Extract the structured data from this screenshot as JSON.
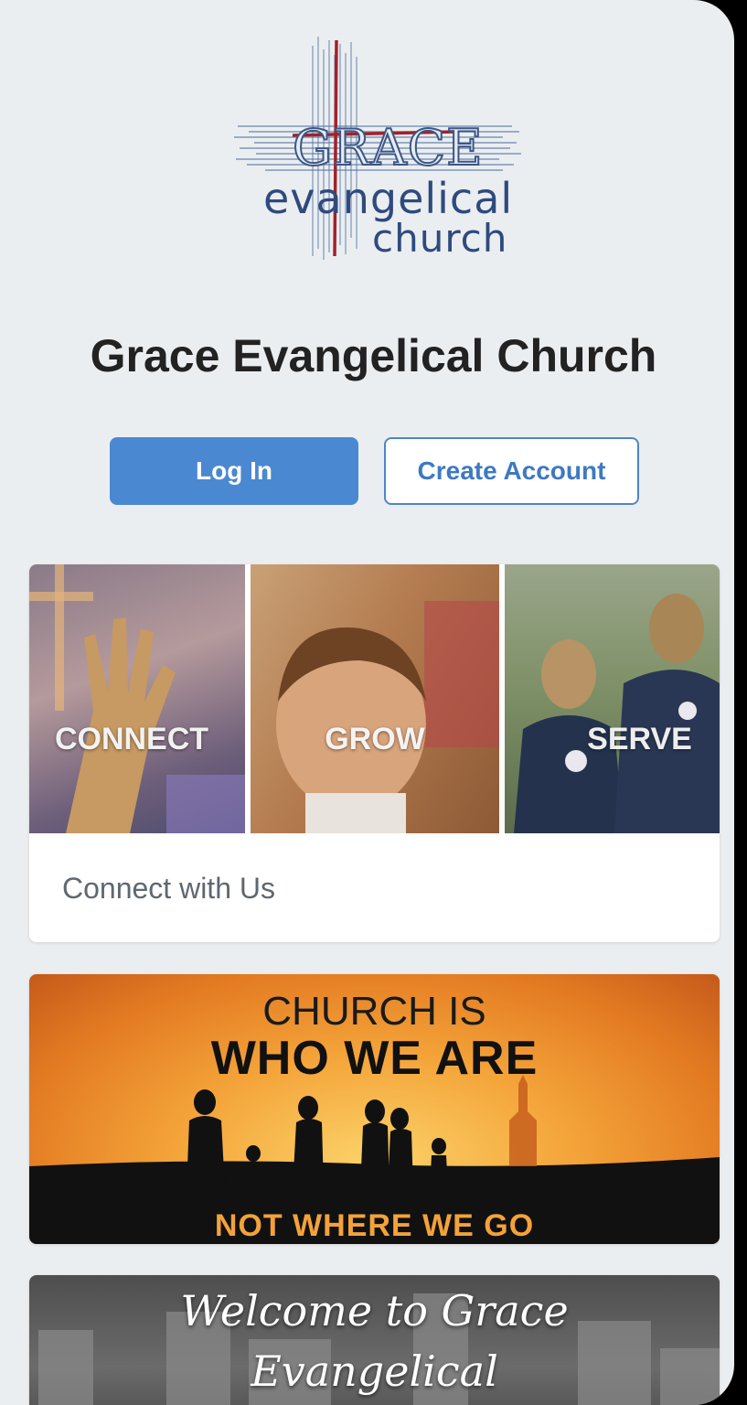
{
  "logo": {
    "word": "GRACE",
    "line1": "evangelical",
    "line2": "church"
  },
  "header": {
    "title": "Grace Evangelical Church"
  },
  "auth": {
    "login_label": "Log In",
    "create_label": "Create Account"
  },
  "cards": {
    "connect": {
      "panels": [
        "CONNECT",
        "GROW",
        "SERVE"
      ],
      "caption": "Connect with Us"
    },
    "church_banner": {
      "line1": "CHURCH IS",
      "line2": "WHO WE ARE",
      "line3": "NOT WHERE WE GO"
    },
    "welcome_banner": {
      "line1": "Welcome to Grace",
      "line2": "Evangelical"
    }
  },
  "colors": {
    "background": "#ebeef0",
    "primary_button": "#4a88d1",
    "secondary_border": "#4d86c8",
    "logo_blue": "#2f4a7e",
    "logo_red": "#a2212a"
  }
}
